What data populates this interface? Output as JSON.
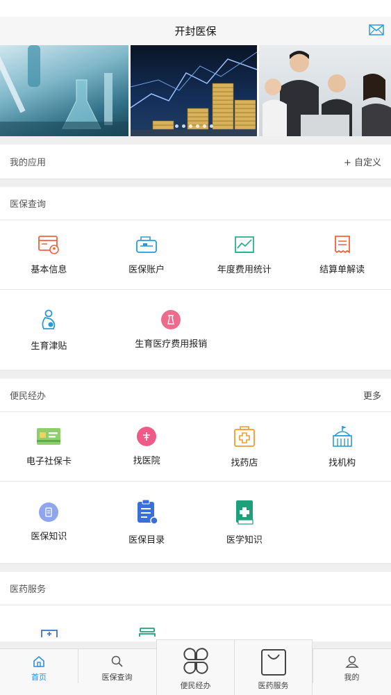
{
  "header": {
    "title": "开封医保"
  },
  "my_apps": {
    "label": "我的应用",
    "action": "+ 自定义"
  },
  "medical_query": {
    "title": "医保查询",
    "items": [
      {
        "label": "基本信息",
        "icon": "basic-info-icon",
        "color": "#f0623c"
      },
      {
        "label": "医保账户",
        "icon": "insurance-account-icon",
        "color": "#2a9ad6"
      },
      {
        "label": "年度费用统计",
        "icon": "annual-stats-icon",
        "color": "#2cb38a"
      },
      {
        "label": "结算单解读",
        "icon": "settlement-icon",
        "color": "#f0623c"
      },
      {
        "label": "生育津贴",
        "icon": "maternity-allowance-icon",
        "color": "#2a9ad6"
      },
      {
        "label": "生育医疗费用报销",
        "icon": "maternity-reimburse-icon",
        "color": "#ef6b8e"
      }
    ]
  },
  "convenience": {
    "title": "便民经办",
    "more": "更多",
    "items": [
      {
        "label": "电子社保卡",
        "icon": "social-card-icon",
        "color": "#6fc06a"
      },
      {
        "label": "找医院",
        "icon": "hospital-icon",
        "color": "#ef5b86"
      },
      {
        "label": "找药店",
        "icon": "pharmacy-icon",
        "color": "#f39a2d"
      },
      {
        "label": "找机构",
        "icon": "institution-icon",
        "color": "#2a9ad6"
      },
      {
        "label": "医保知识",
        "icon": "knowledge-icon",
        "color": "#7b93e8"
      },
      {
        "label": "医保目录",
        "icon": "catalog-icon",
        "color": "#3b6fd8"
      },
      {
        "label": "医学知识",
        "icon": "medical-book-icon",
        "color": "#1ea07a"
      }
    ]
  },
  "medicine_service": {
    "title": "医药服务"
  },
  "tabs": [
    {
      "label": "首页",
      "icon": "home-icon",
      "active": true
    },
    {
      "label": "医保查询",
      "icon": "search-icon",
      "active": false
    },
    {
      "label": "便民经办",
      "icon": "grid-icon",
      "active": false
    },
    {
      "label": "医药服务",
      "icon": "bag-icon",
      "active": false
    },
    {
      "label": "我的",
      "icon": "user-icon",
      "active": false
    }
  ],
  "colors": {
    "accent": "#2a8ee6",
    "background": "#efefef"
  }
}
